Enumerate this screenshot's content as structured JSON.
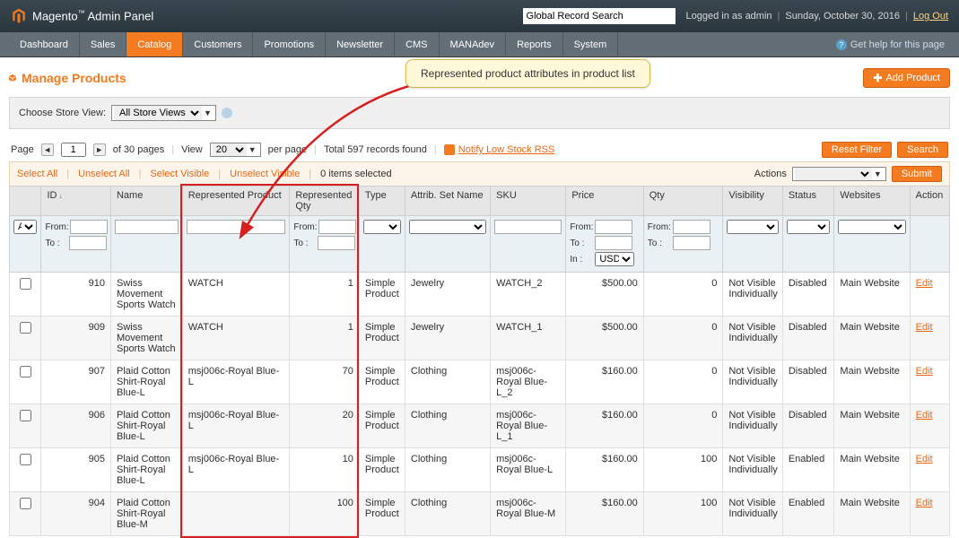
{
  "header": {
    "logo_text": "Magento",
    "logo_suffix": "Admin Panel",
    "search_placeholder": "Global Record Search",
    "logged_in": "Logged in as admin",
    "date": "Sunday, October 30, 2016",
    "logout": "Log Out"
  },
  "nav": {
    "items": [
      "Dashboard",
      "Sales",
      "Catalog",
      "Customers",
      "Promotions",
      "Newsletter",
      "CMS",
      "MANAdev",
      "Reports",
      "System"
    ],
    "active_index": 2,
    "help": "Get help for this page"
  },
  "page": {
    "title": "Manage Products",
    "add_button": "Add Product",
    "callout": "Represented product attributes in product list"
  },
  "storeview": {
    "label": "Choose Store View:",
    "value": "All Store Views"
  },
  "pager": {
    "page_label": "Page",
    "page_value": "1",
    "of_pages": "of 30 pages",
    "view_label": "View",
    "per_page_value": "20",
    "per_page_suffix": "per page",
    "total": "Total 597 records found",
    "rss": "Notify Low Stock RSS",
    "reset": "Reset Filter",
    "search": "Search"
  },
  "massaction": {
    "select_all": "Select All",
    "unselect_all": "Unselect All",
    "select_visible": "Select Visible",
    "unselect_visible": "Unselect Visible",
    "selected": "0 items selected",
    "actions_label": "Actions",
    "submit": "Submit"
  },
  "columns": {
    "chk": "",
    "id": "ID",
    "name": "Name",
    "rep_product": "Represented Product",
    "rep_qty": "Represented Qty",
    "type": "Type",
    "attrib_set": "Attrib. Set Name",
    "sku": "SKU",
    "price": "Price",
    "qty": "Qty",
    "visibility": "Visibility",
    "status": "Status",
    "websites": "Websites",
    "action": "Action"
  },
  "filters": {
    "any": "Any",
    "from": "From:",
    "to": "To :",
    "in": "In :",
    "currency": "USD"
  },
  "rows": [
    {
      "id": "910",
      "name": "Swiss Movement Sports Watch",
      "rep": "WATCH",
      "rqty": "1",
      "type": "Simple Product",
      "aset": "Jewelry",
      "sku": "WATCH_2",
      "price": "$500.00",
      "qty": "0",
      "vis": "Not Visible Individually",
      "status": "Disabled",
      "web": "Main Website",
      "action": "Edit"
    },
    {
      "id": "909",
      "name": "Swiss Movement Sports Watch",
      "rep": "WATCH",
      "rqty": "1",
      "type": "Simple Product",
      "aset": "Jewelry",
      "sku": "WATCH_1",
      "price": "$500.00",
      "qty": "0",
      "vis": "Not Visible Individually",
      "status": "Disabled",
      "web": "Main Website",
      "action": "Edit"
    },
    {
      "id": "907",
      "name": "Plaid Cotton Shirt-Royal Blue-L",
      "rep": "msj006c-Royal Blue-L",
      "rqty": "70",
      "type": "Simple Product",
      "aset": "Clothing",
      "sku": "msj006c-Royal Blue-L_2",
      "price": "$160.00",
      "qty": "0",
      "vis": "Not Visible Individually",
      "status": "Disabled",
      "web": "Main Website",
      "action": "Edit"
    },
    {
      "id": "906",
      "name": "Plaid Cotton Shirt-Royal Blue-L",
      "rep": "msj006c-Royal Blue-L",
      "rqty": "20",
      "type": "Simple Product",
      "aset": "Clothing",
      "sku": "msj006c-Royal Blue-L_1",
      "price": "$160.00",
      "qty": "0",
      "vis": "Not Visible Individually",
      "status": "Disabled",
      "web": "Main Website",
      "action": "Edit"
    },
    {
      "id": "905",
      "name": "Plaid Cotton Shirt-Royal Blue-L",
      "rep": "msj006c-Royal Blue-L",
      "rqty": "10",
      "type": "Simple Product",
      "aset": "Clothing",
      "sku": "msj006c-Royal Blue-L",
      "price": "$160.00",
      "qty": "100",
      "vis": "Not Visible Individually",
      "status": "Enabled",
      "web": "Main Website",
      "action": "Edit"
    },
    {
      "id": "904",
      "name": "Plaid Cotton Shirt-Royal Blue-M",
      "rep": "",
      "rqty": "100",
      "type": "Simple Product",
      "aset": "Clothing",
      "sku": "msj006c-Royal Blue-M",
      "price": "$160.00",
      "qty": "100",
      "vis": "Not Visible Individually",
      "status": "Enabled",
      "web": "Main Website",
      "action": "Edit"
    }
  ]
}
